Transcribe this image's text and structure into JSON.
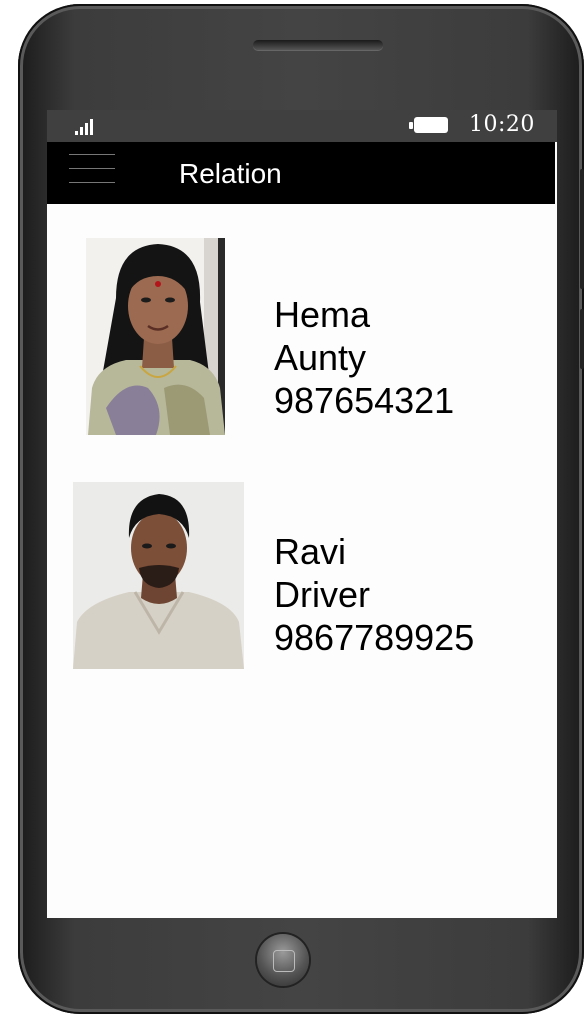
{
  "status_bar": {
    "time": "10:20",
    "signal_icon": "signal-strength-icon",
    "battery_icon": "battery-icon"
  },
  "app_bar": {
    "menu_icon": "hamburger-menu-icon",
    "title": "Relation"
  },
  "contacts": [
    {
      "name": "Hema",
      "relation": "Aunty",
      "phone": "987654321"
    },
    {
      "name": "Ravi",
      "relation": "Driver",
      "phone": "9867789925"
    }
  ],
  "colors": {
    "app_bar": "#000000",
    "status_bar": "#404040",
    "screen_bg": "#fdfdfd",
    "phone_body": "#3c3c3c"
  }
}
